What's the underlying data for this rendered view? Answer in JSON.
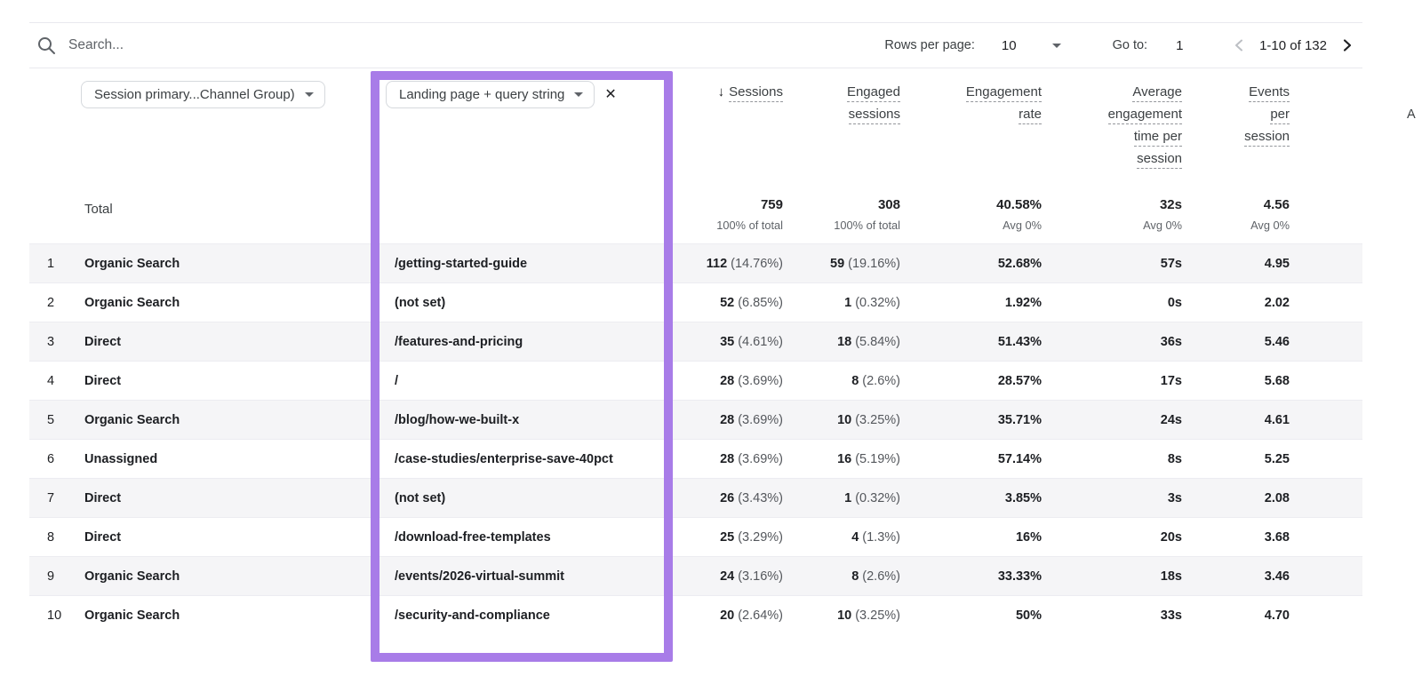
{
  "toolbar": {
    "search_placeholder": "Search...",
    "rows_per_page_label": "Rows per page:",
    "rows_per_page_value": "10",
    "goto_label": "Go to:",
    "goto_value": "1",
    "range": "1-10 of 132"
  },
  "filters": {
    "primary_dimension": "Session primary...Channel Group)",
    "secondary_dimension": "Landing page + query string"
  },
  "icons": {
    "close": "✕",
    "sort_desc": "↓",
    "next_column_partial": "A"
  },
  "highlight_color": "#a87ce8",
  "table": {
    "total_label": "Total",
    "columns": {
      "sessions": {
        "lines": [
          "Sessions"
        ]
      },
      "engaged": {
        "lines": [
          "Engaged",
          "sessions"
        ]
      },
      "rate": {
        "lines": [
          "Engagement",
          "rate"
        ]
      },
      "avg_time": {
        "lines": [
          "Average",
          "engagement",
          "time per",
          "session"
        ]
      },
      "events": {
        "lines": [
          "Events",
          "per",
          "session"
        ]
      }
    },
    "totals": {
      "sessions": {
        "value": "759",
        "sub": "100% of total"
      },
      "engaged": {
        "value": "308",
        "sub": "100% of total"
      },
      "rate": {
        "value": "40.58%",
        "sub": "Avg 0%"
      },
      "avg_time": {
        "value": "32s",
        "sub": "Avg 0%"
      },
      "events": {
        "value": "4.56",
        "sub": "Avg 0%"
      }
    },
    "rows": [
      {
        "num": "1",
        "channel": "Organic Search",
        "landing_page": "/getting-started-guide",
        "sessions": "112",
        "sessions_pct": "(14.76%)",
        "engaged": "59",
        "engaged_pct": "(19.16%)",
        "rate": "52.68%",
        "avg_time": "57s",
        "events": "4.95"
      },
      {
        "num": "2",
        "channel": "Organic Search",
        "landing_page": "(not set)",
        "sessions": "52",
        "sessions_pct": "(6.85%)",
        "engaged": "1",
        "engaged_pct": "(0.32%)",
        "rate": "1.92%",
        "avg_time": "0s",
        "events": "2.02"
      },
      {
        "num": "3",
        "channel": "Direct",
        "landing_page": "/features-and-pricing",
        "sessions": "35",
        "sessions_pct": "(4.61%)",
        "engaged": "18",
        "engaged_pct": "(5.84%)",
        "rate": "51.43%",
        "avg_time": "36s",
        "events": "5.46"
      },
      {
        "num": "4",
        "channel": "Direct",
        "landing_page": "/",
        "sessions": "28",
        "sessions_pct": "(3.69%)",
        "engaged": "8",
        "engaged_pct": "(2.6%)",
        "rate": "28.57%",
        "avg_time": "17s",
        "events": "5.68"
      },
      {
        "num": "5",
        "channel": "Organic Search",
        "landing_page": "/blog/how-we-built-x",
        "sessions": "28",
        "sessions_pct": "(3.69%)",
        "engaged": "10",
        "engaged_pct": "(3.25%)",
        "rate": "35.71%",
        "avg_time": "24s",
        "events": "4.61"
      },
      {
        "num": "6",
        "channel": "Unassigned",
        "landing_page": "/case-studies/enterprise-save-40pct",
        "sessions": "28",
        "sessions_pct": "(3.69%)",
        "engaged": "16",
        "engaged_pct": "(5.19%)",
        "rate": "57.14%",
        "avg_time": "8s",
        "events": "5.25"
      },
      {
        "num": "7",
        "channel": "Direct",
        "landing_page": "(not set)",
        "sessions": "26",
        "sessions_pct": "(3.43%)",
        "engaged": "1",
        "engaged_pct": "(0.32%)",
        "rate": "3.85%",
        "avg_time": "3s",
        "events": "2.08"
      },
      {
        "num": "8",
        "channel": "Direct",
        "landing_page": "/download-free-templates",
        "sessions": "25",
        "sessions_pct": "(3.29%)",
        "engaged": "4",
        "engaged_pct": "(1.3%)",
        "rate": "16%",
        "avg_time": "20s",
        "events": "3.68"
      },
      {
        "num": "9",
        "channel": "Organic Search",
        "landing_page": "/events/2026-virtual-summit",
        "sessions": "24",
        "sessions_pct": "(3.16%)",
        "engaged": "8",
        "engaged_pct": "(2.6%)",
        "rate": "33.33%",
        "avg_time": "18s",
        "events": "3.46"
      },
      {
        "num": "10",
        "channel": "Organic Search",
        "landing_page": "/security-and-compliance",
        "sessions": "20",
        "sessions_pct": "(2.64%)",
        "engaged": "10",
        "engaged_pct": "(3.25%)",
        "rate": "50%",
        "avg_time": "33s",
        "events": "4.70"
      }
    ]
  }
}
